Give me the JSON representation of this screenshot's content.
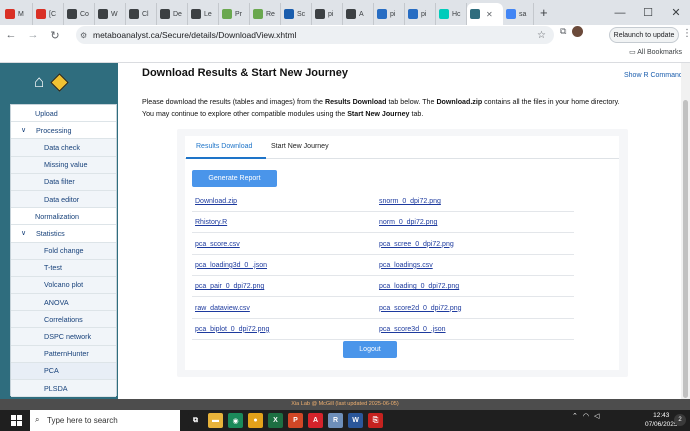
{
  "browser": {
    "tabs": [
      {
        "label": "M",
        "icon": "gmail-icon",
        "color": "#d93025"
      },
      {
        "label": "[C",
        "icon": "gmail-icon",
        "color": "#d93025"
      },
      {
        "label": "Co",
        "icon": "reader-icon",
        "color": "#3c4043"
      },
      {
        "label": "W",
        "icon": "reader-icon",
        "color": "#3c4043"
      },
      {
        "label": "Cl",
        "icon": "reader-icon",
        "color": "#3c4043"
      },
      {
        "label": "De",
        "icon": "reader-icon",
        "color": "#3c4043"
      },
      {
        "label": "Le",
        "icon": "reader-icon",
        "color": "#3c4043"
      },
      {
        "label": "Pr",
        "icon": "grid-icon",
        "color": "#6aa84f"
      },
      {
        "label": "Re",
        "icon": "grid-icon",
        "color": "#6aa84f"
      },
      {
        "label": "Sc",
        "icon": "ncbi-icon",
        "color": "#1a5dad"
      },
      {
        "label": "pi",
        "icon": "reader-icon",
        "color": "#3c4043"
      },
      {
        "label": "A",
        "icon": "reader-icon",
        "color": "#3c4043"
      },
      {
        "label": "pi",
        "icon": "r-icon",
        "color": "#276dc3"
      },
      {
        "label": "pi",
        "icon": "r-icon",
        "color": "#276dc3"
      },
      {
        "label": "Hc",
        "icon": "rg-icon",
        "color": "#00ccbb"
      },
      {
        "label": "",
        "icon": "metaboanalyst-icon",
        "color": "#2f6d7e"
      },
      {
        "label": "sa",
        "icon": "google-icon",
        "color": "#4285f4"
      }
    ],
    "new_tab": "+",
    "window_controls": {
      "minimize": "—",
      "maximize": "☐",
      "close": "✕"
    },
    "back": "←",
    "forward": "→",
    "reload": "↻",
    "url": "metaboanalyst.ca/Secure/details/DownloadView.xhtml",
    "relaunch": "Relaunch to update",
    "all_bookmarks": "All Bookmarks"
  },
  "sidebar": {
    "items": [
      {
        "label": "Upload",
        "kind": "top"
      },
      {
        "label": "Processing",
        "kind": "cat",
        "chevron": "∨"
      },
      {
        "label": "Data check",
        "kind": "sub"
      },
      {
        "label": "Missing value",
        "kind": "sub"
      },
      {
        "label": "Data filter",
        "kind": "sub"
      },
      {
        "label": "Data editor",
        "kind": "sub"
      },
      {
        "label": "Normalization",
        "kind": "top"
      },
      {
        "label": "Statistics",
        "kind": "cat",
        "chevron": "∨"
      },
      {
        "label": "Fold change",
        "kind": "sub"
      },
      {
        "label": "T-test",
        "kind": "sub"
      },
      {
        "label": "Volcano plot",
        "kind": "sub"
      },
      {
        "label": "ANOVA",
        "kind": "sub"
      },
      {
        "label": "Correlations",
        "kind": "sub"
      },
      {
        "label": "DSPC network",
        "kind": "sub"
      },
      {
        "label": "PatternHunter",
        "kind": "sub"
      },
      {
        "label": "PCA",
        "kind": "sub-hl"
      },
      {
        "label": "PLSDA",
        "kind": "sub"
      }
    ]
  },
  "main": {
    "title": "Download Results & Start New Journey",
    "show_r": "Show R Commands",
    "desc": {
      "p1": "Please download the results (tables and images) from the ",
      "b1": "Results Download",
      "p2": " tab below. The ",
      "b2": "Download.zip",
      "p3": " contains all the files in your home directory. You may continue to explore other compatible modules using the ",
      "b3": "Start New Journey",
      "p4": " tab."
    },
    "tabs": [
      "Results Download",
      "Start New Journey"
    ],
    "generate": "Generate Report",
    "files": [
      [
        "Download.zip",
        "snorm_0_dpi72.png"
      ],
      [
        "Rhistory.R",
        "norm_0_dpi72.png"
      ],
      [
        "pca_score.csv",
        "pca_scree_0_dpi72.png"
      ],
      [
        "pca_loading3d_0_.json",
        "pca_loadings.csv"
      ],
      [
        "pca_pair_0_dpi72.png",
        "pca_loading_0_dpi72.png"
      ],
      [
        "raw_dataview.csv",
        "pca_score2d_0_dpi72.png"
      ],
      [
        "pca_biplot_0_dpi72.png",
        "pca_score3d_0_.json"
      ]
    ],
    "logout": "Logout"
  },
  "footer": "Xia Lab @ McGill   (last updated 2025-06-05)",
  "taskbar": {
    "search_placeholder": "Type here to search",
    "apps": [
      {
        "name": "task-view-icon",
        "glyph": "⧉",
        "color": "#1f1f1f"
      },
      {
        "name": "file-explorer-icon",
        "glyph": "▬",
        "color": "#e8b33a"
      },
      {
        "name": "edge-icon",
        "glyph": "◉",
        "color": "#1b8a5a"
      },
      {
        "name": "chrome-icon",
        "glyph": "●",
        "color": "#e3a21a"
      },
      {
        "name": "excel-icon",
        "glyph": "X",
        "color": "#1d6f42"
      },
      {
        "name": "powerpoint-icon",
        "glyph": "P",
        "color": "#d24726"
      },
      {
        "name": "acrobat-icon",
        "glyph": "A",
        "color": "#d5232b"
      },
      {
        "name": "r-icon",
        "glyph": "R",
        "color": "#6e8fb9"
      },
      {
        "name": "word-icon",
        "glyph": "W",
        "color": "#2b579a"
      },
      {
        "name": "pdf-icon",
        "glyph": "⎘",
        "color": "#c5221f"
      }
    ],
    "time": "12:43",
    "date": "07/06/2025",
    "notifications": "2"
  }
}
